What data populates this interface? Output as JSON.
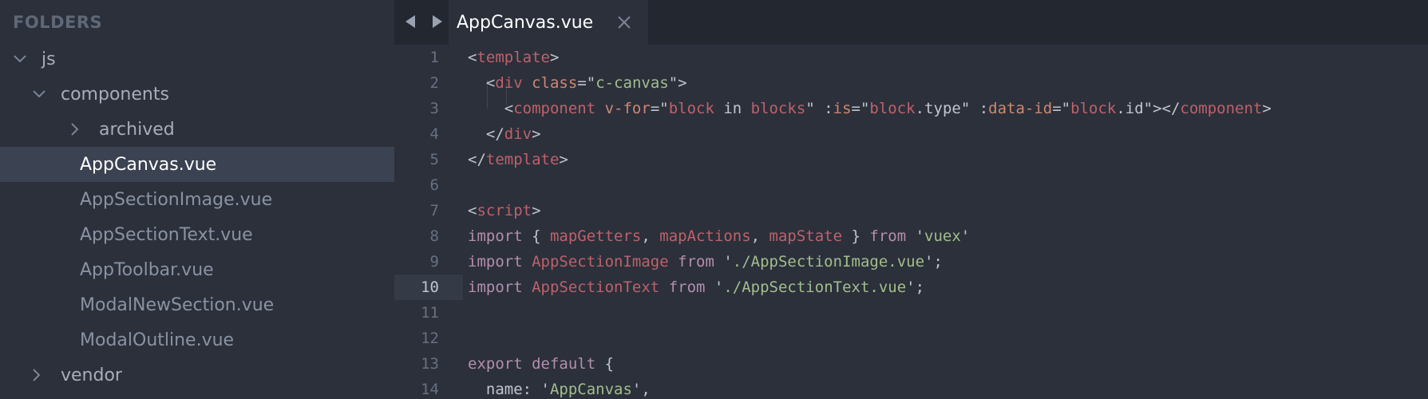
{
  "sidebar": {
    "header": "FOLDERS",
    "items": [
      {
        "label": "js",
        "chevron": "chevron-down-icon",
        "level": 0
      },
      {
        "label": "components",
        "chevron": "chevron-down-icon",
        "level": 1
      },
      {
        "label": "archived",
        "chevron": "chevron-right-icon",
        "level": 2
      },
      {
        "label": "AppCanvas.vue",
        "selected": true,
        "level": 2
      },
      {
        "label": "AppSectionImage.vue",
        "level": 2
      },
      {
        "label": "AppSectionText.vue",
        "level": 2
      },
      {
        "label": "AppToolbar.vue",
        "level": 2
      },
      {
        "label": "ModalNewSection.vue",
        "level": 2
      },
      {
        "label": "ModalOutline.vue",
        "level": 2
      },
      {
        "label": "vendor",
        "chevron": "chevron-right-icon",
        "level": 1
      }
    ]
  },
  "tabs": {
    "active_label": "AppCanvas.vue",
    "back_icon": "arrow-left-icon",
    "forward_icon": "arrow-right-icon",
    "close_icon": "close-icon"
  },
  "editor": {
    "active_line": 10,
    "lines": [
      {
        "num": "1",
        "tokens": [
          [
            "t-punc",
            "<"
          ],
          [
            "t-tag",
            "template"
          ],
          [
            "t-punc",
            ">"
          ]
        ]
      },
      {
        "num": "2",
        "tokens": [
          [
            "t-punc",
            "  <"
          ],
          [
            "t-tag",
            "div"
          ],
          [
            "t-punc",
            " "
          ],
          [
            "t-attr",
            "class"
          ],
          [
            "t-punc",
            "=\""
          ],
          [
            "t-str",
            "c-canvas"
          ],
          [
            "t-punc",
            "\">"
          ]
        ]
      },
      {
        "num": "3",
        "tokens": [
          [
            "t-punc",
            "    <"
          ],
          [
            "t-tag",
            "component"
          ],
          [
            "t-punc",
            " "
          ],
          [
            "t-attr",
            "v-for"
          ],
          [
            "t-punc",
            "=\""
          ],
          [
            "t-tag",
            "block"
          ],
          [
            "t-plain",
            " in "
          ],
          [
            "t-tag",
            "blocks"
          ],
          [
            "t-punc",
            "\" :"
          ],
          [
            "t-attr",
            "is"
          ],
          [
            "t-punc",
            "=\""
          ],
          [
            "t-tag",
            "block"
          ],
          [
            "t-plain",
            ".type"
          ],
          [
            "t-punc",
            "\" :"
          ],
          [
            "t-attr",
            "data-id"
          ],
          [
            "t-punc",
            "=\""
          ],
          [
            "t-tag",
            "block"
          ],
          [
            "t-plain",
            ".id"
          ],
          [
            "t-punc",
            "\"></"
          ],
          [
            "t-tag",
            "component"
          ],
          [
            "t-punc",
            ">"
          ]
        ]
      },
      {
        "num": "4",
        "tokens": [
          [
            "t-punc",
            "  </"
          ],
          [
            "t-tag",
            "div"
          ],
          [
            "t-punc",
            ">"
          ]
        ]
      },
      {
        "num": "5",
        "tokens": [
          [
            "t-punc",
            "</"
          ],
          [
            "t-tag",
            "template"
          ],
          [
            "t-punc",
            ">"
          ]
        ]
      },
      {
        "num": "6",
        "tokens": []
      },
      {
        "num": "7",
        "tokens": [
          [
            "t-punc",
            "<"
          ],
          [
            "t-tag",
            "script"
          ],
          [
            "t-punc",
            ">"
          ]
        ]
      },
      {
        "num": "8",
        "tokens": [
          [
            "t-kw",
            "import"
          ],
          [
            "t-punc",
            " { "
          ],
          [
            "t-tag",
            "mapGetters"
          ],
          [
            "t-punc",
            ", "
          ],
          [
            "t-tag",
            "mapActions"
          ],
          [
            "t-punc",
            ", "
          ],
          [
            "t-tag",
            "mapState"
          ],
          [
            "t-punc",
            " } "
          ],
          [
            "t-kw",
            "from"
          ],
          [
            "t-punc",
            " '"
          ],
          [
            "t-str",
            "vuex"
          ],
          [
            "t-punc",
            "'"
          ]
        ]
      },
      {
        "num": "9",
        "tokens": [
          [
            "t-kw",
            "import"
          ],
          [
            "t-punc",
            " "
          ],
          [
            "t-tag",
            "AppSectionImage"
          ],
          [
            "t-punc",
            " "
          ],
          [
            "t-kw",
            "from"
          ],
          [
            "t-punc",
            " '"
          ],
          [
            "t-str",
            "./AppSectionImage.vue"
          ],
          [
            "t-punc",
            "';"
          ]
        ]
      },
      {
        "num": "10",
        "tokens": [
          [
            "t-kw",
            "import"
          ],
          [
            "t-punc",
            " "
          ],
          [
            "t-tag",
            "AppSectionText"
          ],
          [
            "t-punc",
            " "
          ],
          [
            "t-kw",
            "from"
          ],
          [
            "t-punc",
            " '"
          ],
          [
            "t-str",
            "./AppSectionText.vue"
          ],
          [
            "t-punc",
            "';"
          ]
        ]
      },
      {
        "num": "11",
        "tokens": []
      },
      {
        "num": "12",
        "tokens": []
      },
      {
        "num": "13",
        "tokens": [
          [
            "t-kw",
            "export"
          ],
          [
            "t-punc",
            " "
          ],
          [
            "t-kw",
            "default"
          ],
          [
            "t-punc",
            " {"
          ]
        ]
      },
      {
        "num": "14",
        "tokens": [
          [
            "t-plain",
            "  name: '"
          ],
          [
            "t-str",
            "AppCanvas"
          ],
          [
            "t-plain",
            "',"
          ]
        ]
      }
    ]
  },
  "colors": {
    "background": "#2b303b",
    "tabbar": "#222730",
    "selection": "#3b4252",
    "tag": "#bf616a",
    "attribute": "#d08770",
    "string": "#a3be8c",
    "keyword": "#b48ead"
  }
}
